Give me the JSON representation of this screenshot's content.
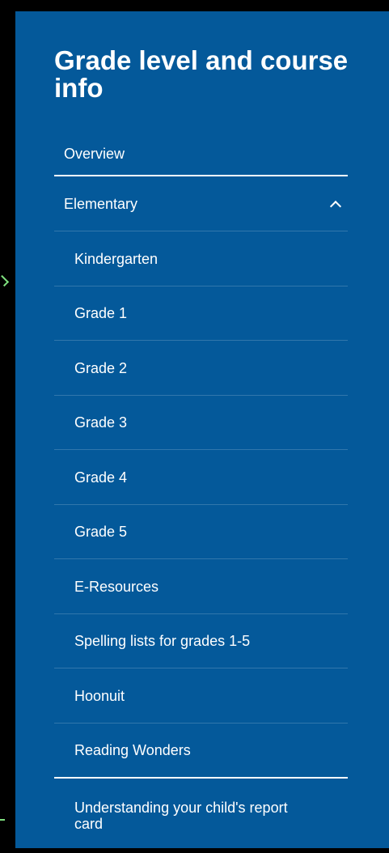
{
  "sidebar": {
    "title": "Grade level and course info",
    "overview": "Overview",
    "elementary": {
      "label": "Elementary",
      "expand_icon": "chevron-up-icon",
      "items": [
        "Kindergarten",
        "Grade 1",
        "Grade 2",
        "Grade 3",
        "Grade 4",
        "Grade 5",
        "E-Resources",
        "Spelling lists for grades 1-5",
        "Hoonuit",
        "Reading Wonders"
      ]
    },
    "report_card": "Understanding your child's report card"
  },
  "colors": {
    "panel": "#04599a",
    "background": "#000000",
    "text": "#ffffff"
  }
}
